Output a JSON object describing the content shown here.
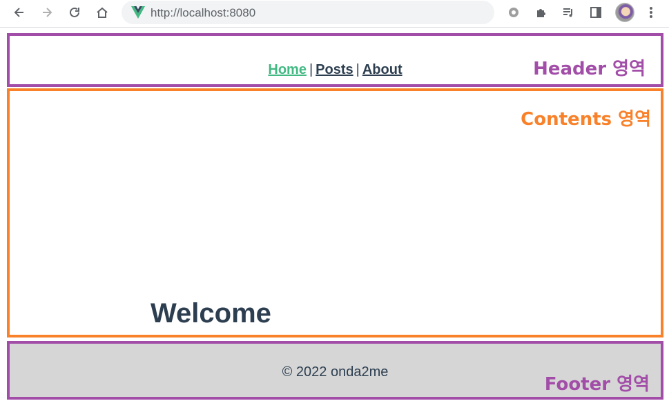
{
  "browser": {
    "url": "http://localhost:8080",
    "icons": [
      "back-arrow-icon",
      "forward-arrow-icon",
      "reload-icon",
      "home-icon",
      "vue-logo-icon",
      "gear-extension-icon",
      "puzzle-extensions-icon",
      "media-queue-icon",
      "side-panel-icon",
      "profile-avatar",
      "kebab-menu-icon"
    ]
  },
  "header": {
    "nav": {
      "home": "Home",
      "posts": "Posts",
      "about": "About",
      "separator": "|"
    },
    "label": "Header 영역"
  },
  "contents": {
    "label": "Contents 영역",
    "heading": "Welcome"
  },
  "footer": {
    "copyright": "© 2022 onda2me",
    "label": "Footer 영역"
  },
  "colors": {
    "header_border": "#a24ea8",
    "contents_border": "#f8812a",
    "footer_border": "#a24ea8",
    "footer_bg": "#d6d6d6",
    "active_link": "#42b983",
    "text": "#2c3e50"
  }
}
